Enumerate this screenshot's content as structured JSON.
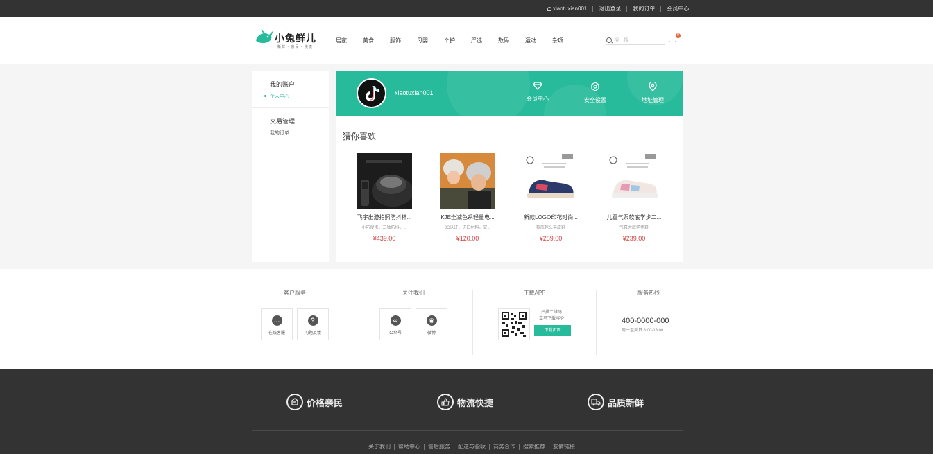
{
  "topbar": {
    "username": "xiaotuxian001",
    "logout": "退出登录",
    "orders": "我的订单",
    "member": "会员中心"
  },
  "logo": {
    "name": "小兔鲜儿",
    "slogan": "新鲜 · 亲民 · 快捷"
  },
  "nav": [
    "居家",
    "美食",
    "服饰",
    "母婴",
    "个护",
    "严选",
    "数码",
    "运动",
    "杂项"
  ],
  "search": {
    "placeholder": "搜一搜"
  },
  "cart": {
    "count": "0"
  },
  "sidebar": {
    "account_heading": "我的账户",
    "profile_item": "个人中心",
    "trade_heading": "交易管理",
    "orders_item": "我的订单"
  },
  "profile": {
    "username": "xiaotuxian001",
    "links": [
      {
        "label": "会员中心",
        "icon": "diamond-icon"
      },
      {
        "label": "安全设置",
        "icon": "shield-icon"
      },
      {
        "label": "地址管理",
        "icon": "location-icon"
      }
    ]
  },
  "guess": {
    "title": "猜你喜欢",
    "goods": [
      {
        "name": "飞宇出游拍照防抖神...",
        "desc": "小巧便携，三轴防抖，...",
        "price": "¥439.00"
      },
      {
        "name": "KJE全减色系轻量电...",
        "desc": "3C认证，进口材料，安...",
        "price": "¥120.00"
      },
      {
        "name": "新款LOGO印花时尚...",
        "desc": "软底包头羊皮鞋",
        "price": "¥259.00"
      },
      {
        "name": "儿童气泵软底学步二...",
        "desc": "气泵大底学步鞋",
        "price": "¥239.00"
      }
    ]
  },
  "service": {
    "customer": {
      "title": "客户服务",
      "online": "在线客服",
      "feedback": "问题反馈"
    },
    "follow": {
      "title": "关注我们",
      "wechat": "公众号",
      "weibo": "微博"
    },
    "app": {
      "title": "下载APP",
      "line1": "扫描二维码",
      "line2": "立马下载APP",
      "button": "下载页面"
    },
    "hotline": {
      "title": "服务热线",
      "phone": "400-0000-000",
      "hours": "周一至周日 8:00-18:00"
    }
  },
  "promises": [
    "价格亲民",
    "物流快捷",
    "品质新鲜"
  ],
  "footer_links": [
    "关于我们",
    "帮助中心",
    "售后服务",
    "配送与验收",
    "商务合作",
    "搜索推荐",
    "友情链接"
  ],
  "colors": {
    "brand": "#27ba9b",
    "price": "#cf4444",
    "dark": "#333333"
  }
}
